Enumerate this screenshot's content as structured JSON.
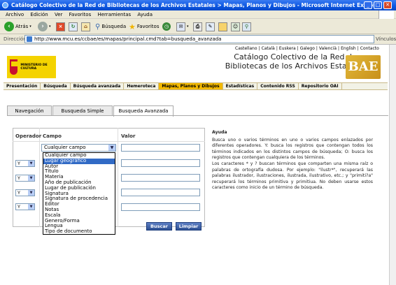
{
  "window": {
    "title": "Catálogo Colectivo de la Red de Bibliotecas de los Archivos Estatales > Mapas, Planos y Dibujos - Microsoft Internet Explorer",
    "controls": [
      "_",
      "□",
      "✕"
    ]
  },
  "menu": [
    "Archivo",
    "Edición",
    "Ver",
    "Favoritos",
    "Herramientas",
    "Ayuda"
  ],
  "toolbar": {
    "back_label": "Atrás",
    "search_label": "Búsqueda",
    "favorites_label": "Favoritos"
  },
  "address": {
    "label": "Dirección",
    "url": "http://www.mcu.es/ccbae/es/mapas/principal.cmd?tab=busqueda_avanzada",
    "links_label": "Vínculos"
  },
  "header": {
    "languages": [
      "Castellano",
      "Català",
      "Euskera",
      "Galego",
      "Valencià",
      "English",
      "Contacto"
    ],
    "ministry": "MINISTERIO DE CULTURA",
    "title_line1": "Catálogo Colectivo de la Red de",
    "title_line2": "Bibliotecas de los Archivos Estatales",
    "logo_text": "BAE"
  },
  "nav": [
    {
      "label": "Presentación",
      "active": false
    },
    {
      "label": "Búsqueda",
      "active": false
    },
    {
      "label": "Búsqueda avanzada",
      "active": false
    },
    {
      "label": "Hemeroteca",
      "active": false
    },
    {
      "label": "Mapas, Planos y Dibujos",
      "active": true
    },
    {
      "label": "Estadísticas",
      "active": false
    },
    {
      "label": "Contenido RSS",
      "active": false
    },
    {
      "label": "Repositorio OAI",
      "active": false
    }
  ],
  "tabs": [
    {
      "label": "Navegación",
      "active": false
    },
    {
      "label": "Busqueda Simple",
      "active": false
    },
    {
      "label": "Busqueda Avanzada",
      "active": true
    }
  ],
  "form": {
    "col_operador": "Operador",
    "col_campo": "Campo",
    "col_valor": "Valor",
    "campo_selected": "Cualquier campo",
    "operator_value": "Y",
    "search_button": "Buscar",
    "clear_button": "Limpiar"
  },
  "dropdown_options": [
    {
      "label": "Cualquier campo",
      "highlighted": false
    },
    {
      "label": "Lugar geográfico",
      "highlighted": true
    },
    {
      "label": "Autor",
      "highlighted": false
    },
    {
      "label": "Título",
      "highlighted": false
    },
    {
      "label": "Materia",
      "highlighted": false
    },
    {
      "label": "Año de publicación",
      "highlighted": false
    },
    {
      "label": "Lugar de publicación",
      "highlighted": false
    },
    {
      "label": "Signatura",
      "highlighted": false
    },
    {
      "label": "Signatura de procedencia",
      "highlighted": false
    },
    {
      "label": "Editor",
      "highlighted": false
    },
    {
      "label": "Notas",
      "highlighted": false
    },
    {
      "label": "Escala",
      "highlighted": false
    },
    {
      "label": "Genero/Forma",
      "highlighted": false
    },
    {
      "label": "Lengua",
      "highlighted": false
    },
    {
      "label": "Tipo de documento",
      "highlighted": false
    }
  ],
  "help": {
    "title": "Ayuda",
    "p1": "Busca uno o varios términos en uno o varios campos enlazados por diferentes operadores. Y: busca los registros que contengan todos los términos indicados en los distintos campos de búsqueda; O: busca los registros que contengan cualquiera de los términos.",
    "p2": "Los caracteres * y ? buscan términos que comparten una misma raíz o palabras de ortografía dudosa. Por ejemplo: \"ilustr*\", recuperará las palabras ilustrador, ilustraciones, ilustrada, ilustrativo, etc.; y \"primiti?a\" recuperará los términos primitiva y primitiua. No deben usarse estos caracteres como inicio de un término de búsqueda."
  }
}
